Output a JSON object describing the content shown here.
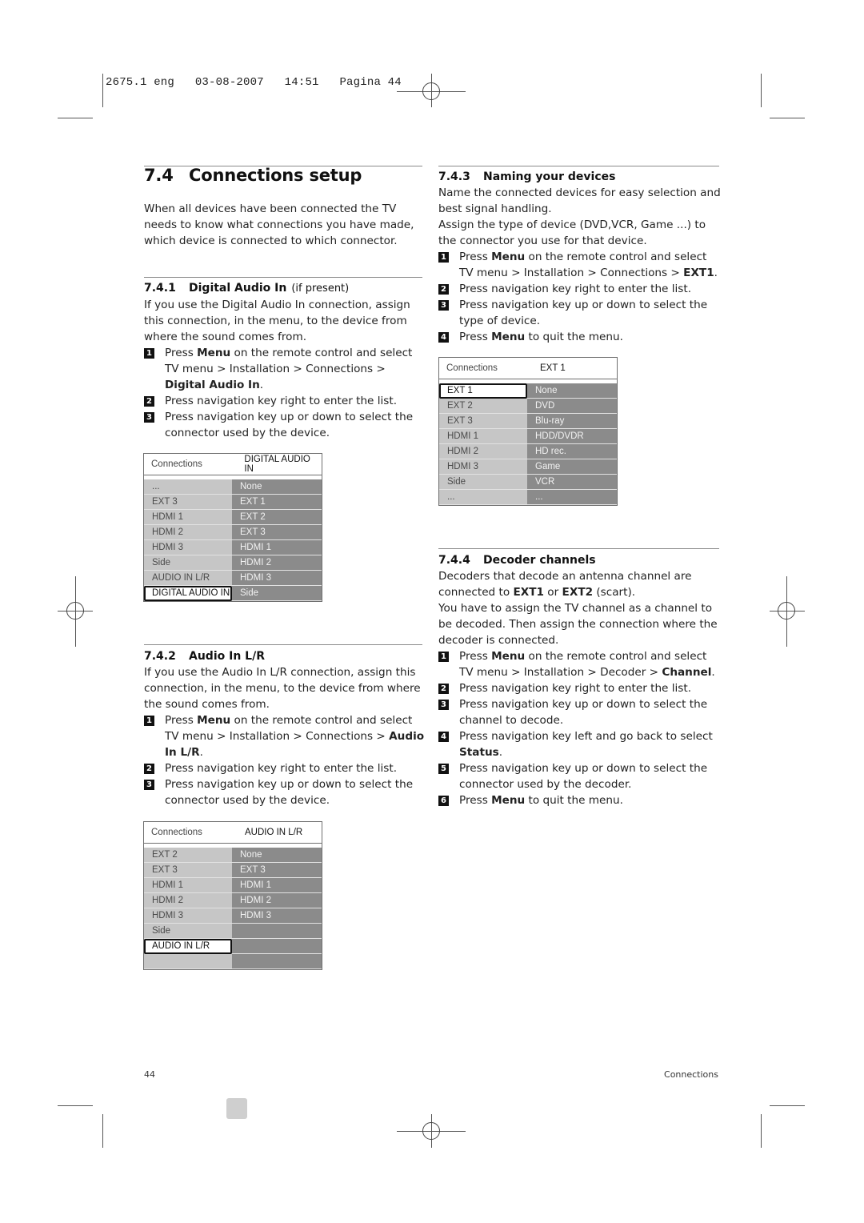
{
  "slug": "2675.1 eng   03-08-2007   14:51   Pagina 44",
  "section": {
    "number": "7.4",
    "title": "Connections setup",
    "intro": "When all devices have been connected the TV needs to know what connections you have made, which device is connected to which connector."
  },
  "digital_audio": {
    "number": "7.4.1",
    "title": "Digital Audio In",
    "note": "(if present)",
    "text": "If you use the Digital Audio In connection, assign this connection, in the menu, to the device from where the sound comes from.",
    "steps": [
      {
        "n": "1",
        "pre": "Press ",
        "bold1": "Menu",
        "mid": " on the remote control and select TV menu > Installation > Connections > ",
        "bold2": "Digital Audio In",
        "post": "."
      },
      {
        "n": "2",
        "text": "Press navigation key right to enter the list."
      },
      {
        "n": "3",
        "text": "Press navigation key up or down to select the connector used by the device."
      }
    ],
    "menu": {
      "left_header": "Connections",
      "right_header": "DIGITAL AUDIO IN",
      "left": [
        "...",
        "EXT 3",
        "HDMI 1",
        "HDMI 2",
        "HDMI 3",
        "Side",
        "AUDIO IN L/R",
        "DIGITAL AUDIO IN"
      ],
      "right": [
        "None",
        "EXT 1",
        "EXT 2",
        "EXT 3",
        "HDMI 1",
        "HDMI 2",
        "HDMI 3",
        "Side"
      ],
      "selected": "DIGITAL AUDIO IN"
    }
  },
  "audio_lr": {
    "number": "7.4.2",
    "title": "Audio In L/R",
    "text": "If you use the Audio In L/R connection, assign this connection, in the menu, to the device from where the sound comes from.",
    "steps": [
      {
        "n": "1",
        "pre": "Press ",
        "bold1": "Menu",
        "mid": " on the remote control and select TV menu > Installation > Connections > ",
        "bold2": "Audio In L/R",
        "post": "."
      },
      {
        "n": "2",
        "text": "Press navigation key right to enter the list."
      },
      {
        "n": "3",
        "text": "Press navigation key up or down to select the connector used by the device."
      }
    ],
    "menu": {
      "left_header": "Connections",
      "right_header": "AUDIO IN L/R",
      "left": [
        "EXT 2",
        "EXT 3",
        "HDMI 1",
        "HDMI 2",
        "HDMI 3",
        "Side",
        "AUDIO IN L/R",
        ""
      ],
      "right": [
        "None",
        "EXT 3",
        "HDMI 1",
        "HDMI 2",
        "HDMI 3",
        "",
        "",
        ""
      ],
      "selected": "AUDIO IN L/R"
    }
  },
  "naming": {
    "number": "7.4.3",
    "title": "Naming your devices",
    "text1": "Name the connected devices for easy selection and best signal handling.",
    "text2": "Assign the type of device (DVD,VCR, Game ...) to the connector you use for that device.",
    "steps": [
      {
        "n": "1",
        "pre": "Press ",
        "bold1": "Menu",
        "mid": " on the remote control and select TV menu > Installation > Connections > ",
        "bold2": "EXT1",
        "post": "."
      },
      {
        "n": "2",
        "text": "Press navigation key right to enter the list."
      },
      {
        "n": "3",
        "text": "Press navigation key up or down to select the type of device."
      },
      {
        "n": "4",
        "pre": "Press ",
        "bold1": "Menu",
        "mid": " to quit the menu.",
        "bold2": "",
        "post": ""
      }
    ],
    "menu": {
      "left_header": "Connections",
      "right_header": "EXT 1",
      "left": [
        "EXT 1",
        "EXT 2",
        "EXT 3",
        "HDMI 1",
        "HDMI 2",
        "HDMI 3",
        "Side",
        "..."
      ],
      "right": [
        "None",
        "DVD",
        "Blu-ray",
        "HDD/DVDR",
        "HD rec.",
        "Game",
        "VCR",
        "..."
      ],
      "selected": "EXT 1"
    }
  },
  "decoder": {
    "number": "7.4.4",
    "title": "Decoder channels",
    "text1_pre": "Decoders that decode an antenna channel are connected to ",
    "text1_b1": "EXT1",
    "text1_mid": " or ",
    "text1_b2": "EXT2",
    "text1_post": " (scart).",
    "text2": "You have to assign the TV channel as a channel to be decoded. Then assign the connection where the decoder is connected.",
    "steps": [
      {
        "n": "1",
        "pre": "Press ",
        "bold1": "Menu",
        "mid": " on the remote control and select TV menu > Installation > Decoder > ",
        "bold2": "Channel",
        "post": "."
      },
      {
        "n": "2",
        "text": "Press navigation key right to enter the list."
      },
      {
        "n": "3",
        "text": "Press navigation key up or down to select the channel to decode."
      },
      {
        "n": "4",
        "pre": "Press navigation key left and go back to select ",
        "bold1": "Status",
        "mid": ".",
        "bold2": "",
        "post": ""
      },
      {
        "n": "5",
        "text": "Press navigation key up or down to select the connector used by the decoder."
      },
      {
        "n": "6",
        "pre": "Press ",
        "bold1": "Menu",
        "mid": " to quit the menu.",
        "bold2": "",
        "post": ""
      }
    ]
  },
  "footer": {
    "page_number": "44",
    "section_name": "Connections"
  }
}
